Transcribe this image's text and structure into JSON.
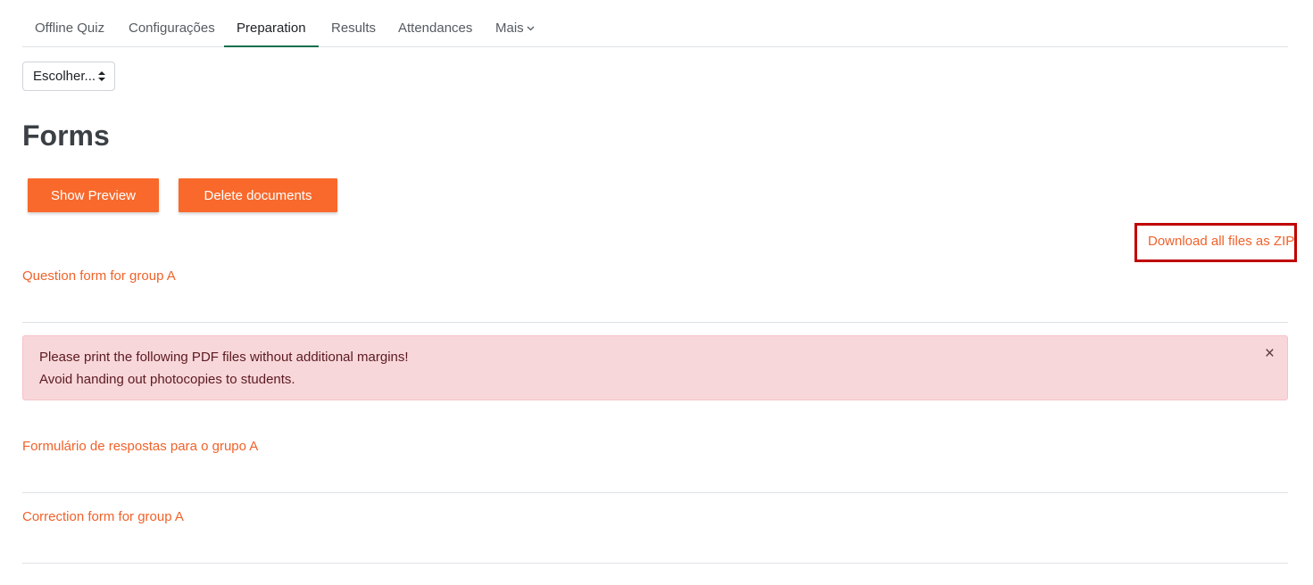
{
  "tabs": [
    {
      "label": "Offline Quiz"
    },
    {
      "label": "Configurações"
    },
    {
      "label": "Preparation",
      "active": true
    },
    {
      "label": "Results"
    },
    {
      "label": "Attendances"
    },
    {
      "label": "Mais",
      "icon": "chevron-down-icon"
    }
  ],
  "select": {
    "value": "Escolher...",
    "icon": "sort-caret-icon"
  },
  "page": {
    "title": "Forms"
  },
  "buttons": {
    "preview": "Show Preview",
    "delete": "Delete documents"
  },
  "download_zip": "Download all files as ZIP",
  "forms": {
    "question": "Question form for group A",
    "answer": "Formulário de respostas para o grupo A",
    "correction": "Correction form for group A"
  },
  "alert": {
    "line1": "Please print the following PDF files without additional margins!",
    "line2": "Avoid handing out photocopies to students.",
    "close": "×"
  },
  "colors": {
    "accent": "#f8692b",
    "link": "#f0622a",
    "active_tab_border": "#0f6e4b",
    "alert_bg": "#f8d7da",
    "highlight": "#c00000"
  }
}
